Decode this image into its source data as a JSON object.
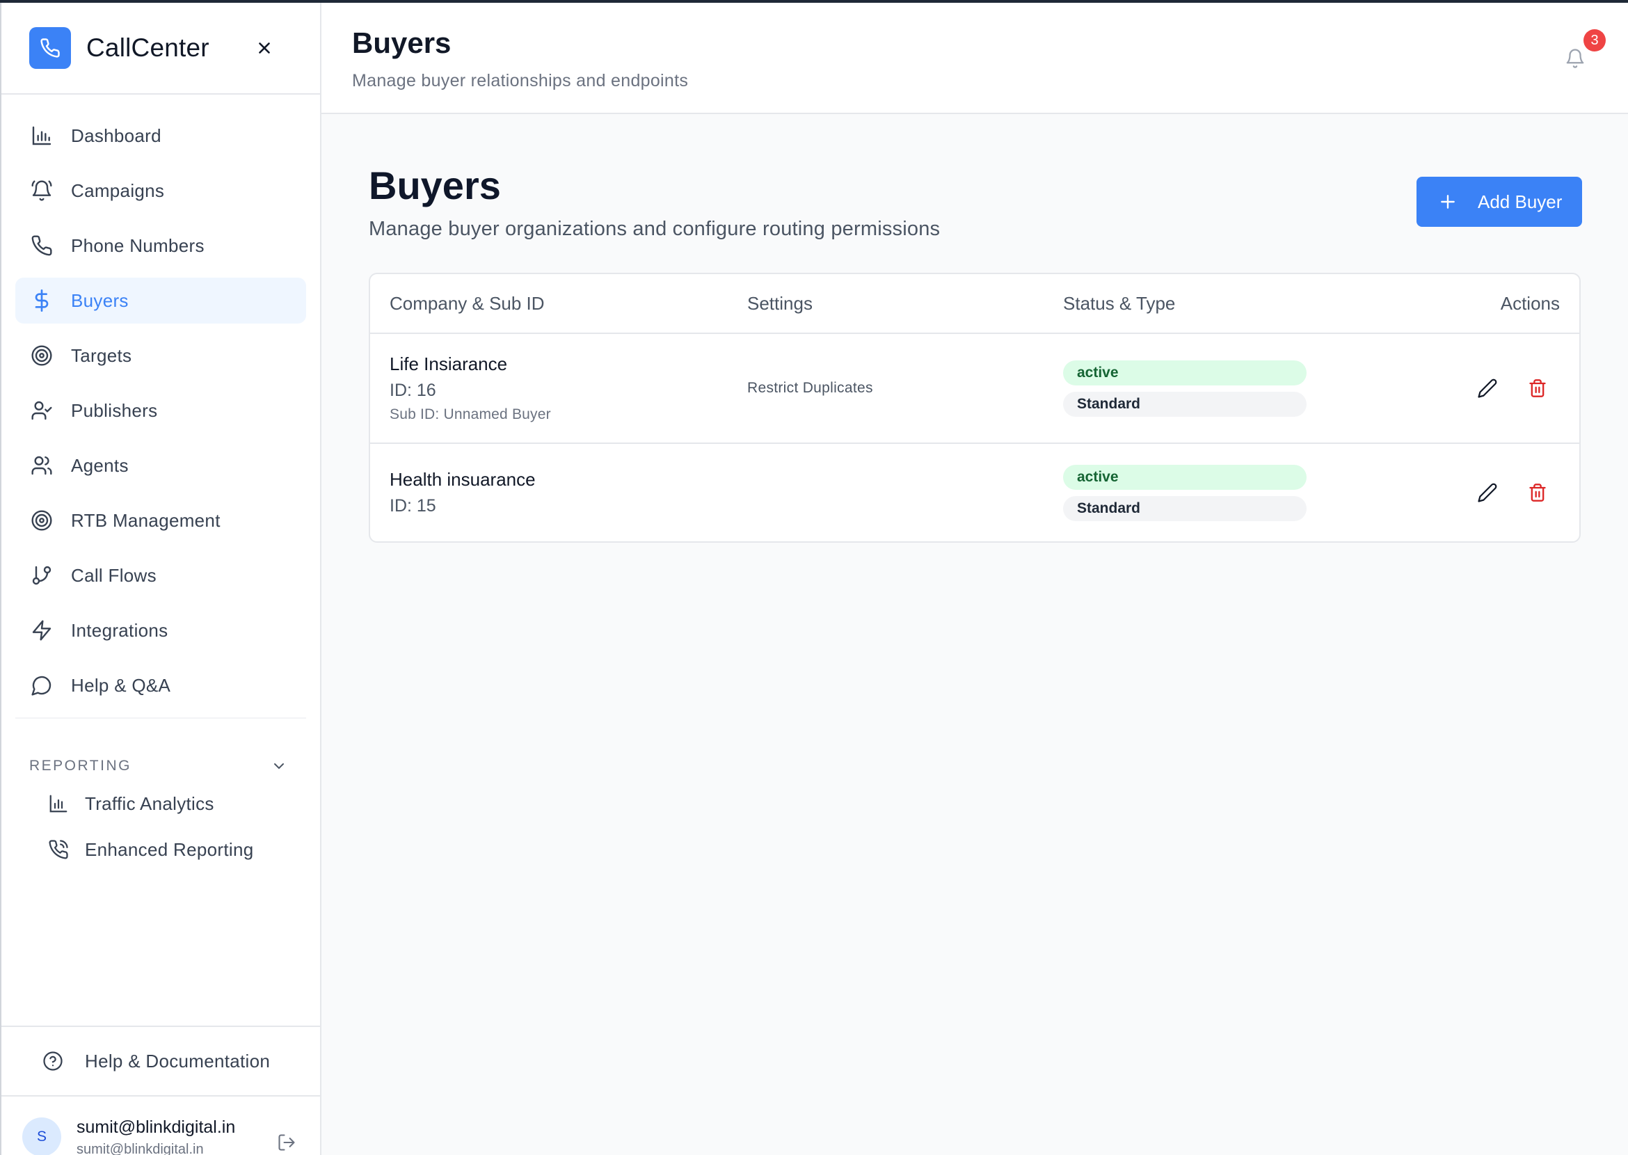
{
  "sidebar": {
    "brand": "CallCenter",
    "items": [
      {
        "label": "Dashboard",
        "icon": "bar-chart-icon"
      },
      {
        "label": "Campaigns",
        "icon": "bell-ring-icon"
      },
      {
        "label": "Phone Numbers",
        "icon": "phone-icon"
      },
      {
        "label": "Buyers",
        "icon": "dollar-icon",
        "active": true
      },
      {
        "label": "Targets",
        "icon": "target-icon"
      },
      {
        "label": "Publishers",
        "icon": "user-check-icon"
      },
      {
        "label": "Agents",
        "icon": "users-icon"
      },
      {
        "label": "RTB Management",
        "icon": "target-icon"
      },
      {
        "label": "Call Flows",
        "icon": "git-branch-icon"
      },
      {
        "label": "Integrations",
        "icon": "zap-icon"
      },
      {
        "label": "Help & Q&A",
        "icon": "message-circle-icon"
      }
    ],
    "reporting": {
      "title": "REPORTING",
      "items": [
        {
          "label": "Traffic Analytics",
          "icon": "bar-chart-icon"
        },
        {
          "label": "Enhanced Reporting",
          "icon": "phone-call-icon"
        }
      ]
    },
    "help_doc": "Help & Documentation",
    "user": {
      "initial": "S",
      "name": "sumit@blinkdigital.in",
      "email": "sumit@blinkdigital.in"
    }
  },
  "header": {
    "title": "Buyers",
    "subtitle": "Manage buyer relationships and endpoints",
    "notifications": "3"
  },
  "page": {
    "title": "Buyers",
    "subtitle": "Manage buyer organizations and configure routing permissions",
    "add_button": "Add Buyer"
  },
  "table": {
    "headers": [
      "Company & Sub ID",
      "Settings",
      "Status & Type",
      "Actions"
    ],
    "rows": [
      {
        "company": "Life Insiarance",
        "id": "ID: 16",
        "sub_id": "Sub ID: Unnamed Buyer",
        "settings": "Restrict Duplicates",
        "status": "active",
        "type": "Standard"
      },
      {
        "company": "Health insuarance",
        "id": "ID: 15",
        "sub_id": "",
        "settings": "",
        "status": "active",
        "type": "Standard"
      }
    ]
  },
  "colors": {
    "accent": "#3b82f6",
    "danger": "#dc2626",
    "status_bg": "#dcfce7",
    "status_text": "#166534"
  }
}
